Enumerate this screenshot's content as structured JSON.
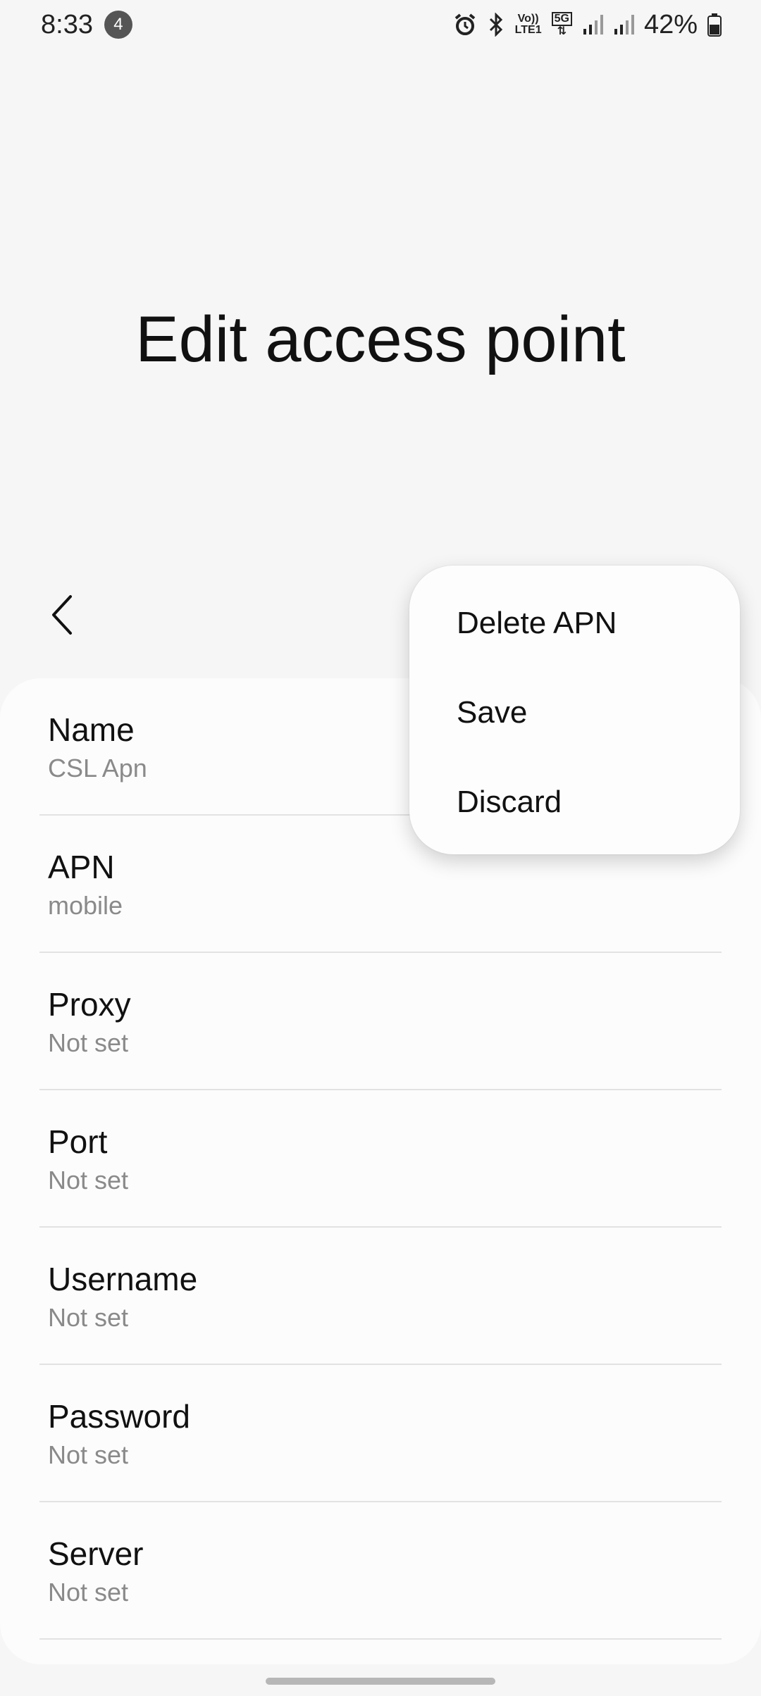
{
  "status_bar": {
    "time": "8:33",
    "notification_count": "4",
    "network_tag_top": "Vo))",
    "network_tag_bottom": "LTE1",
    "network_5g": "5G",
    "battery_percent": "42%"
  },
  "header": {
    "title": "Edit access point",
    "back_icon": "chevron-left-icon"
  },
  "popup_menu": {
    "items": [
      "Delete APN",
      "Save",
      "Discard"
    ]
  },
  "fields": [
    {
      "label": "Name",
      "value": "CSL Apn"
    },
    {
      "label": "APN",
      "value": "mobile"
    },
    {
      "label": "Proxy",
      "value": "Not set"
    },
    {
      "label": "Port",
      "value": "Not set"
    },
    {
      "label": "Username",
      "value": "Not set"
    },
    {
      "label": "Password",
      "value": "Not set"
    },
    {
      "label": "Server",
      "value": "Not set"
    }
  ],
  "colors": {
    "background": "#f6f6f6",
    "card": "#fcfcfc",
    "secondary_text": "#8a8a8a"
  }
}
